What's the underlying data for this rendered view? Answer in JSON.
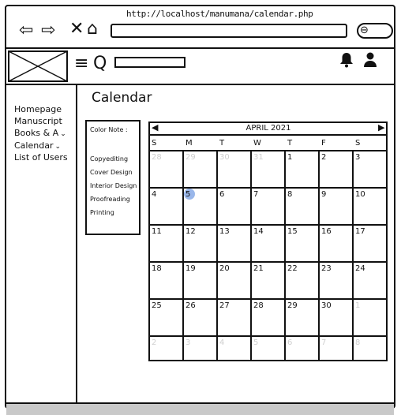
{
  "browser": {
    "url": "http://localhost/manumana/calendar.php"
  },
  "topbar": {
    "hamburger_glyph": "≡",
    "search_glyph": "Q",
    "bell_glyph": "🔔",
    "user_glyph": "👤"
  },
  "sidebar": {
    "items": [
      {
        "label": "Homepage",
        "expandable": false
      },
      {
        "label": "Manuscript",
        "expandable": false
      },
      {
        "label": "Books & A",
        "expandable": true
      },
      {
        "label": "Calendar",
        "expandable": true
      },
      {
        "label": "List of Users",
        "expandable": false
      }
    ],
    "chevron": "⌄"
  },
  "page": {
    "title": "Calendar"
  },
  "legend": {
    "title": "Color Note :",
    "items": [
      "Copyediting",
      "Cover Design",
      "Interior Design",
      "Proofreading",
      "Printing"
    ]
  },
  "calendar": {
    "month_label": "APRIL 2021",
    "prev_glyph": "◀",
    "next_glyph": "▶",
    "weekdays": [
      "S",
      "M",
      "T",
      "W",
      "T",
      "F",
      "S"
    ],
    "today": 5,
    "weeks": [
      [
        {
          "d": "28",
          "m": true
        },
        {
          "d": "29",
          "m": true
        },
        {
          "d": "30",
          "m": true
        },
        {
          "d": "31",
          "m": true
        },
        {
          "d": "1"
        },
        {
          "d": "2"
        },
        {
          "d": "3"
        }
      ],
      [
        {
          "d": "4"
        },
        {
          "d": "5"
        },
        {
          "d": "6"
        },
        {
          "d": "7"
        },
        {
          "d": "8"
        },
        {
          "d": "9"
        },
        {
          "d": "10"
        }
      ],
      [
        {
          "d": "11"
        },
        {
          "d": "12"
        },
        {
          "d": "13"
        },
        {
          "d": "14"
        },
        {
          "d": "15"
        },
        {
          "d": "16"
        },
        {
          "d": "17"
        }
      ],
      [
        {
          "d": "18"
        },
        {
          "d": "19"
        },
        {
          "d": "20"
        },
        {
          "d": "21"
        },
        {
          "d": "22"
        },
        {
          "d": "23"
        },
        {
          "d": "24"
        }
      ],
      [
        {
          "d": "25"
        },
        {
          "d": "26"
        },
        {
          "d": "27"
        },
        {
          "d": "28"
        },
        {
          "d": "29"
        },
        {
          "d": "30"
        },
        {
          "d": "1",
          "m": true
        }
      ],
      [
        {
          "d": "2",
          "m": true
        },
        {
          "d": "3",
          "m": true
        },
        {
          "d": "4",
          "m": true
        },
        {
          "d": "5",
          "m": true
        },
        {
          "d": "6",
          "m": true
        },
        {
          "d": "7",
          "m": true
        },
        {
          "d": "8",
          "m": true
        }
      ]
    ]
  },
  "colors": {
    "today_highlight": "#9ab7ea",
    "muted_day": "#cfcfcf"
  }
}
